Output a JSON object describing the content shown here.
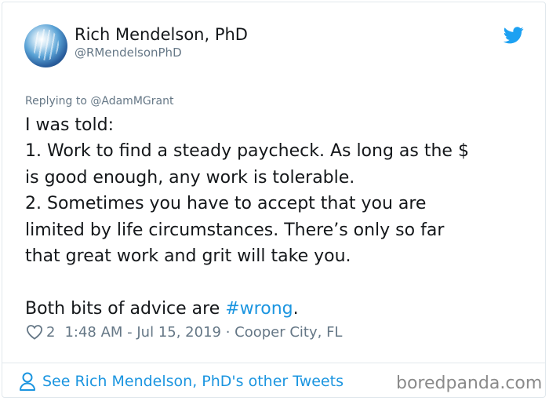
{
  "user": {
    "name": "Rich Mendelson, PhD",
    "handle": "@RMendelsonPhD"
  },
  "tweet": {
    "replying_to": "Replying to @AdamMGrant",
    "lines": [
      "I was told:",
      "1. Work to find a steady paycheck. As long as the $",
      "is good enough, any work is tolerable.",
      "2. Sometimes you have to accept that you are",
      "limited by life circumstances. There’s only so far",
      "that great work and grit will take you."
    ],
    "last_line_prefix": "Both bits of advice are ",
    "hashtag": "#wrong",
    "last_line_suffix": ".",
    "likes": "2",
    "timestamp": "1:48 AM - Jul 15, 2019 · Cooper City, FL"
  },
  "footer": {
    "link_label": "See Rich Mendelson, PhD's other Tweets",
    "watermark": "boredpanda.com"
  },
  "colors": {
    "link": "#1b95e0",
    "text": "#14171a",
    "muted": "#657786",
    "twitter_blue": "#1da1f2"
  },
  "icons": [
    "twitter-bird-icon",
    "heart-icon",
    "person-icon"
  ]
}
